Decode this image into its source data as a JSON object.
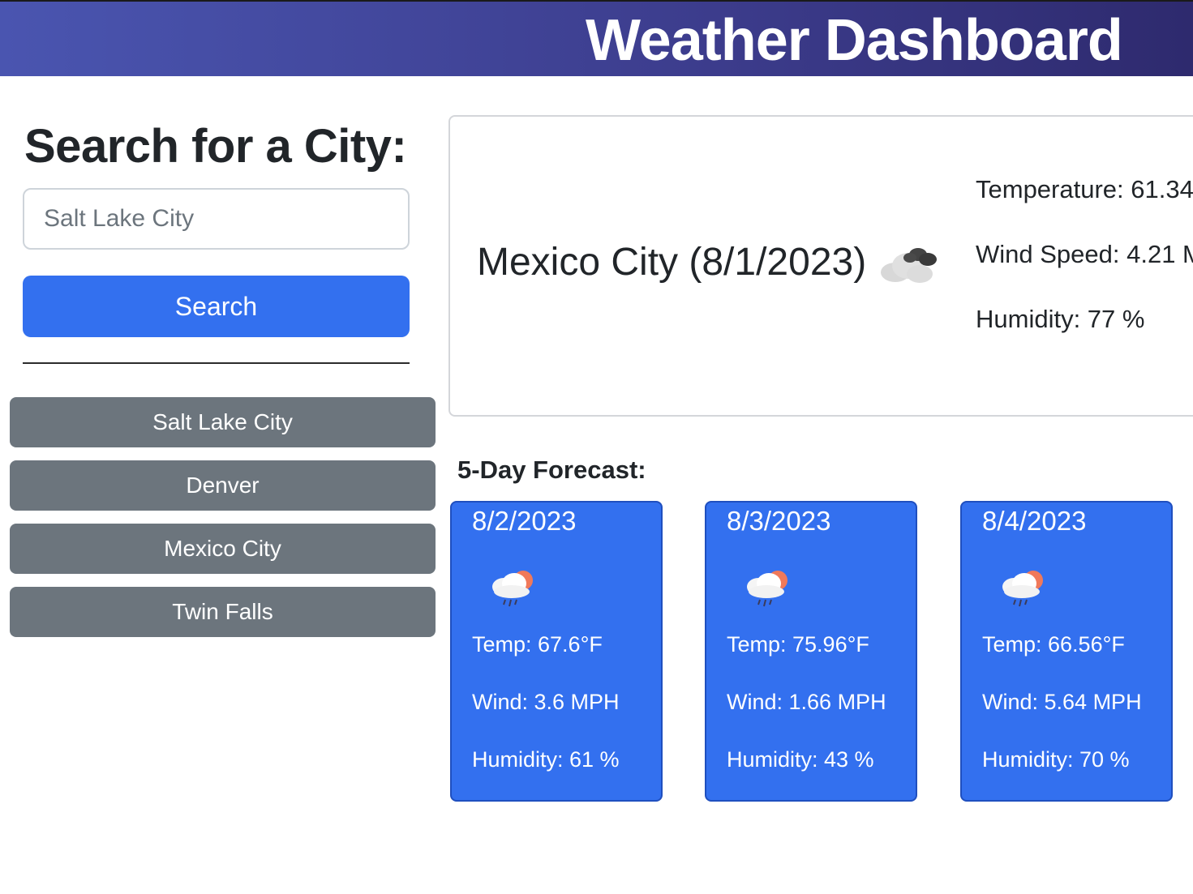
{
  "header": {
    "title": "Weather Dashboard"
  },
  "search": {
    "heading": "Search for a City:",
    "placeholder": "Salt Lake City",
    "button_label": "Search"
  },
  "history": [
    {
      "label": "Salt Lake City"
    },
    {
      "label": "Denver"
    },
    {
      "label": "Mexico City"
    },
    {
      "label": "Twin Falls"
    }
  ],
  "current": {
    "city_date": "Mexico City (8/1/2023)",
    "icon": "broken-clouds-icon",
    "temperature": "Temperature: 61.34",
    "wind": "Wind Speed: 4.21 M",
    "humidity": "Humidity: 77 %"
  },
  "forecast": {
    "heading": "5-Day Forecast:",
    "days": [
      {
        "date": "8/2/2023",
        "icon": "rain-sun-cloud-icon",
        "temp": "Temp: 67.6°F",
        "wind": "Wind: 3.6 MPH",
        "humidity": "Humidity: 61 %"
      },
      {
        "date": "8/3/2023",
        "icon": "rain-sun-cloud-icon",
        "temp": "Temp: 75.96°F",
        "wind": "Wind: 1.66 MPH",
        "humidity": "Humidity: 43 %"
      },
      {
        "date": "8/4/2023",
        "icon": "rain-sun-cloud-icon",
        "temp": "Temp: 66.56°F",
        "wind": "Wind: 5.64 MPH",
        "humidity": "Humidity: 70 %"
      }
    ]
  },
  "colors": {
    "header_gradient_start": "#4a55b0",
    "header_gradient_end": "#2e2a6e",
    "primary_blue": "#3370ef",
    "history_gray": "#6c757d"
  }
}
